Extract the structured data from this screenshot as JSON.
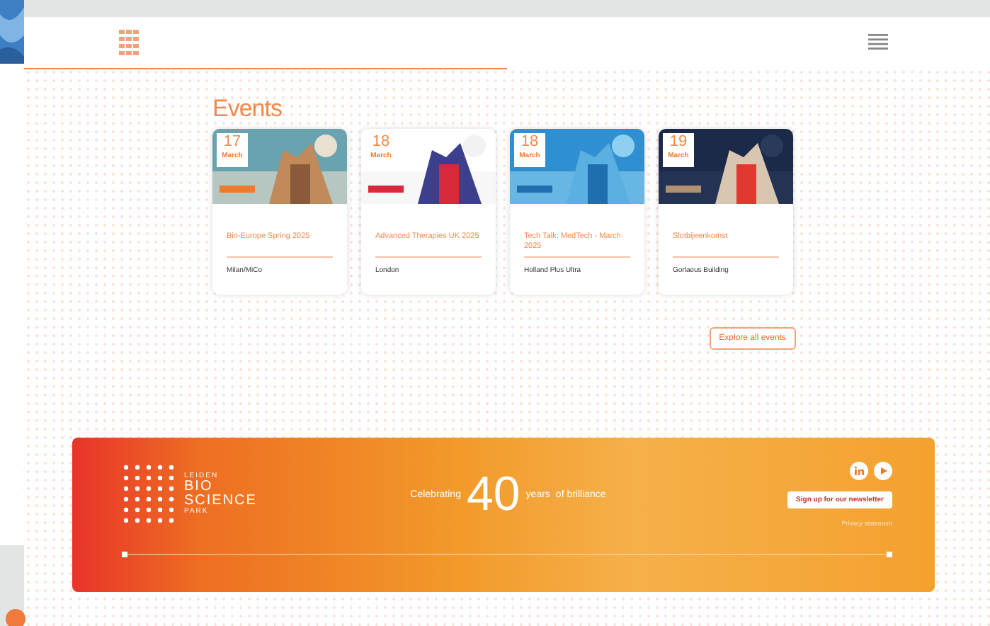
{
  "events": {
    "title": "Events",
    "cards": [
      {
        "day": "17",
        "month": "March",
        "title": "Bio-Europe Spring 2025",
        "location": "Milan/MiCo"
      },
      {
        "day": "18",
        "month": "March",
        "title": "Advanced Therapies UK 2025",
        "location": "London"
      },
      {
        "day": "18",
        "month": "March",
        "title": "Tech Talk: MedTech - March 2025",
        "location": "Holland Plus Ultra"
      },
      {
        "day": "19",
        "month": "March",
        "title": "Slotbijeenkomst",
        "location": "Gorlaeus Building"
      }
    ],
    "explore_button": "Explore all events"
  },
  "banner": {
    "logo_lines": [
      "LEIDEN",
      "BIO",
      "SCIENCE",
      "PARK"
    ],
    "celebrating": "Celebrating",
    "number": "40",
    "years": "years",
    "brilliance": "of brilliance",
    "newsletter_button": "Sign up for our newsletter",
    "privacy_link": "Privacy statement"
  }
}
